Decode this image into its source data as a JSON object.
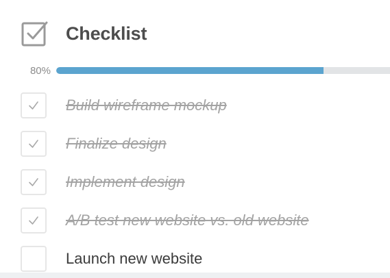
{
  "checklist": {
    "title": "Checklist",
    "icon": "checkbox-icon",
    "progress": {
      "label": "80%",
      "value": 0.8
    },
    "items": [
      {
        "label": "Build wireframe mockup",
        "checked": true
      },
      {
        "label": "Finalize design",
        "checked": true
      },
      {
        "label": "Implement design",
        "checked": true
      },
      {
        "label": "A/B test new website vs. old website",
        "checked": true
      },
      {
        "label": "Launch new website",
        "checked": false
      }
    ]
  },
  "colors": {
    "progress_fill": "#5ba4cf",
    "progress_track": "#e2e4e6",
    "done_text": "#a3a3a3",
    "todo_text": "#3b3b3b",
    "title_text": "#4d4d4d"
  }
}
